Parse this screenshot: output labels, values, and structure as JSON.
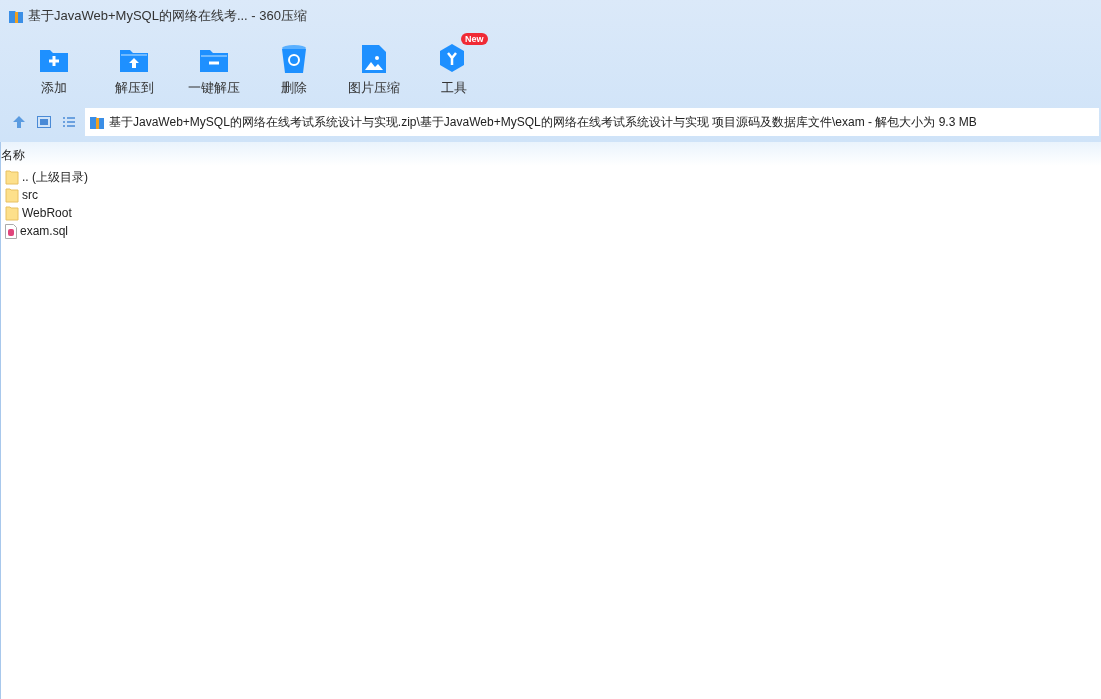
{
  "window": {
    "title": "基于JavaWeb+MySQL的网络在线考... - 360压缩"
  },
  "toolbar": [
    {
      "label": "添加",
      "kind": "add"
    },
    {
      "label": "解压到",
      "kind": "extract-to"
    },
    {
      "label": "一键解压",
      "kind": "quick-extract"
    },
    {
      "label": "删除",
      "kind": "delete"
    },
    {
      "label": "图片压缩",
      "kind": "image"
    },
    {
      "label": "工具",
      "kind": "tools",
      "badge": "New"
    }
  ],
  "address_bar": {
    "path": "基于JavaWeb+MySQL的网络在线考试系统设计与实现.zip\\基于JavaWeb+MySQL的网络在线考试系统设计与实现 项目源码及数据库文件\\exam - 解包大小为 9.3 MB"
  },
  "file_list": {
    "columns": [
      "名称"
    ],
    "rows": [
      {
        "name": ".. (上级目录)",
        "kind": "folder"
      },
      {
        "name": "src",
        "kind": "folder"
      },
      {
        "name": "WebRoot",
        "kind": "folder"
      },
      {
        "name": "exam.sql",
        "kind": "sql"
      }
    ]
  }
}
